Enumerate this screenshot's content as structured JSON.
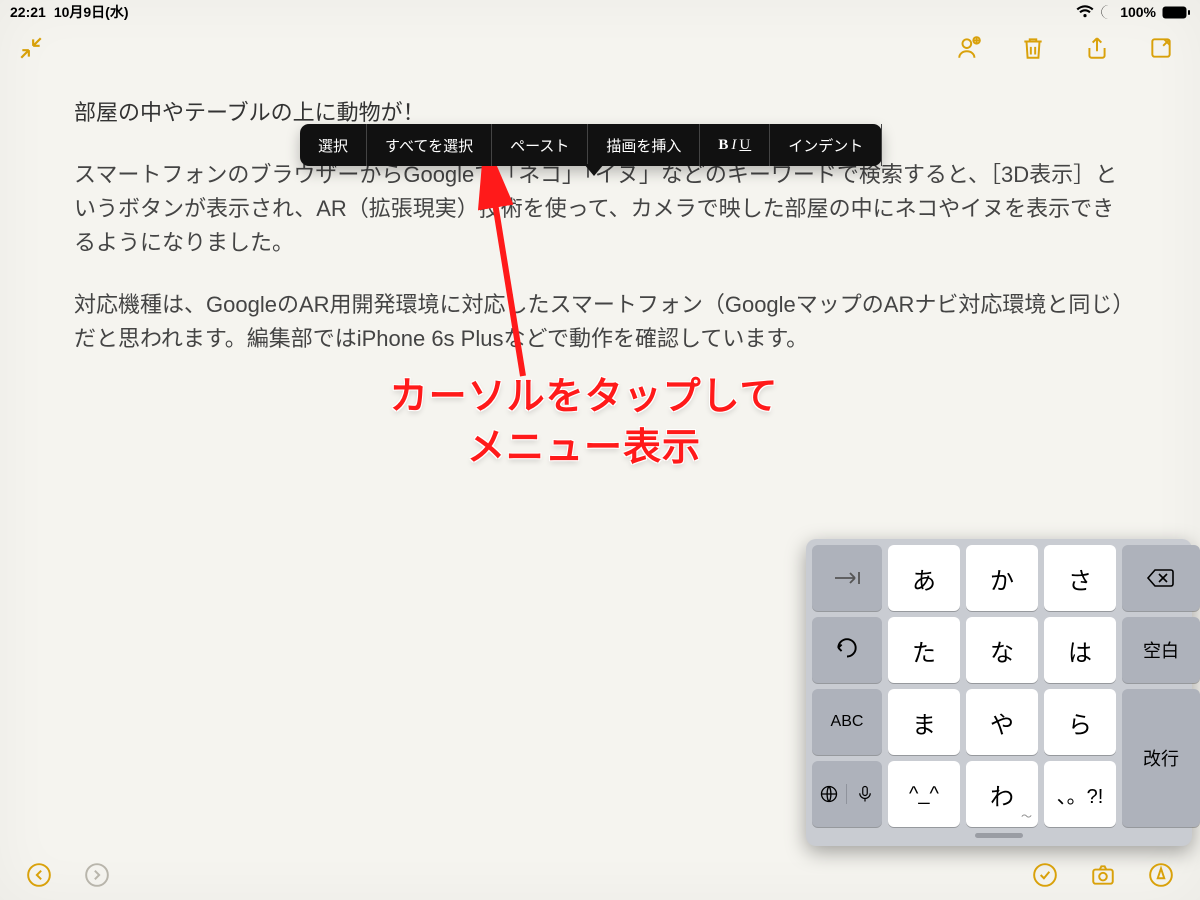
{
  "status": {
    "time": "22:21",
    "date": "10月9日(水)",
    "battery": "100%"
  },
  "note": {
    "title_line": "部屋の中やテーブルの上に動物が！",
    "para1": "スマートフォンのブラウザーからGoogleで「ネコ」「イヌ」などのキーワードで検索すると、［3D表示］というボタンが表示され、AR（拡張現実）技術を使って、カメラで映した部屋の中にネコやイヌを表示できるようになりました。",
    "para2": "対応機種は、GoogleのAR用開発環境に対応したスマートフォン（GoogleマップのARナビ対応環境と同じ）だと思われます。編集部ではiPhone 6s Plusなどで動作を確認しています。"
  },
  "context_menu": {
    "items": [
      "選択",
      "すべてを選択",
      "ペースト",
      "描画を挿入",
      "BIU",
      "インデント"
    ]
  },
  "annotation": {
    "line1": "カーソルをタップして",
    "line2": "メニュー表示"
  },
  "keyboard": {
    "rows": [
      [
        "tab-icon",
        "あ",
        "か",
        "さ",
        "delete-icon"
      ],
      [
        "undo-icon",
        "た",
        "な",
        "は",
        "空白"
      ],
      [
        "ABC",
        "ま",
        "や",
        "ら",
        "改行"
      ],
      [
        "globe-mic",
        "^_^",
        "わ",
        "、。?!",
        ""
      ]
    ],
    "abc_label": "ABC",
    "space_label": "空白",
    "return_label": "改行",
    "kaomoji": "^_^",
    "punct": "、。?!"
  }
}
